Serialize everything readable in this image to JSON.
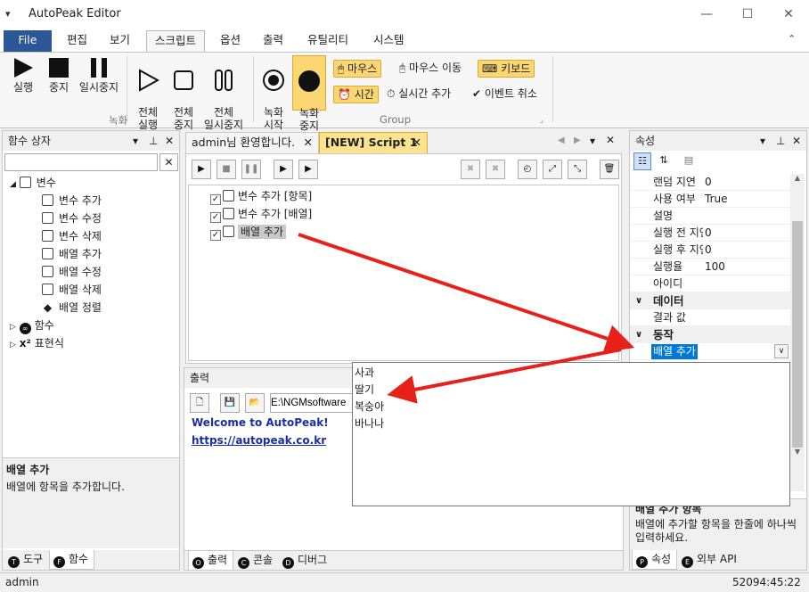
{
  "window": {
    "title": "AutoPeak Editor",
    "app_icon": "menu-icon"
  },
  "menu": {
    "tabs": [
      "File",
      "편집",
      "보기",
      "스크립트",
      "옵션",
      "출력",
      "유틸리티",
      "시스템"
    ],
    "active": "스크립트"
  },
  "ribbon": {
    "record_group": {
      "label": "녹화",
      "buttons": [
        {
          "label": "실행"
        },
        {
          "label": "중지"
        },
        {
          "label": "일시중지"
        },
        {
          "label": "전체\n실행"
        },
        {
          "label": "전체\n중지"
        },
        {
          "label": "전체\n일시중지"
        }
      ]
    },
    "group": {
      "label": "Group",
      "start_label": "녹화\n시작",
      "stop_label": "녹화\n중지",
      "mouse_label": "마우스",
      "mouse_move_label": "마우스 이동",
      "keyboard_label": "키보드",
      "time_label": "시간",
      "realtime_label": "실시간 추가",
      "event_cancel_label": "이벤트 취소"
    }
  },
  "left_panel": {
    "title": "함수 상자",
    "search_value": "",
    "tree": {
      "variables": "변수",
      "items": [
        "변수 추가",
        "변수 수정",
        "변수 삭제",
        "배열 추가",
        "배열 수정",
        "배열 삭제",
        "배열 정렬"
      ],
      "functions": "함수",
      "expressions": "표현식"
    },
    "desc_title": "배열 추가",
    "desc_text": "배열에 항목을 추가합니다.",
    "tabs": [
      "도구",
      "함수"
    ]
  },
  "doc_tabs": [
    {
      "label": "admin님 환영합니다."
    },
    {
      "label": "[NEW] Script 1"
    }
  ],
  "script_items": [
    "변수 추가 [항목]",
    "변수 추가 [배열]",
    "배열 추가"
  ],
  "output_panel": {
    "title": "출력",
    "path_value": "E:\\NGMsoftware",
    "welcome": "Welcome to AutoPeak!",
    "link": "https://autopeak.co.kr",
    "tabs": [
      "출력",
      "콘솔",
      "디버그"
    ]
  },
  "properties": {
    "title": "속성",
    "rows": [
      {
        "name": "랜덤 지연",
        "value": "0"
      },
      {
        "name": "사용 여부",
        "value": "True"
      },
      {
        "name": "설명",
        "value": ""
      },
      {
        "name": "실행 전 지연",
        "value": "0"
      },
      {
        "name": "실행 후 지연",
        "value": "0"
      },
      {
        "name": "실행율",
        "value": "100"
      },
      {
        "name": "아이디",
        "value": ""
      }
    ],
    "cat_data": "데이터",
    "result_name": "결과 값",
    "cat_action": "동작",
    "action_value": "배열 추가",
    "dropdown_items": [
      "사과",
      "딸기",
      "복숭아",
      "바나나"
    ],
    "desc_title": "배열 추가 항목",
    "desc_text": "배열에 추가할 항목을 한줄에 하나씩 입력하세요.",
    "tabs": [
      "속성",
      "외부 API"
    ]
  },
  "status": {
    "user": "admin",
    "time": "52094:45:22"
  },
  "colors": {
    "accent": "#2b5797",
    "highlight": "#fbd774",
    "arrow": "#e8201a",
    "selection": "#0078d7"
  }
}
